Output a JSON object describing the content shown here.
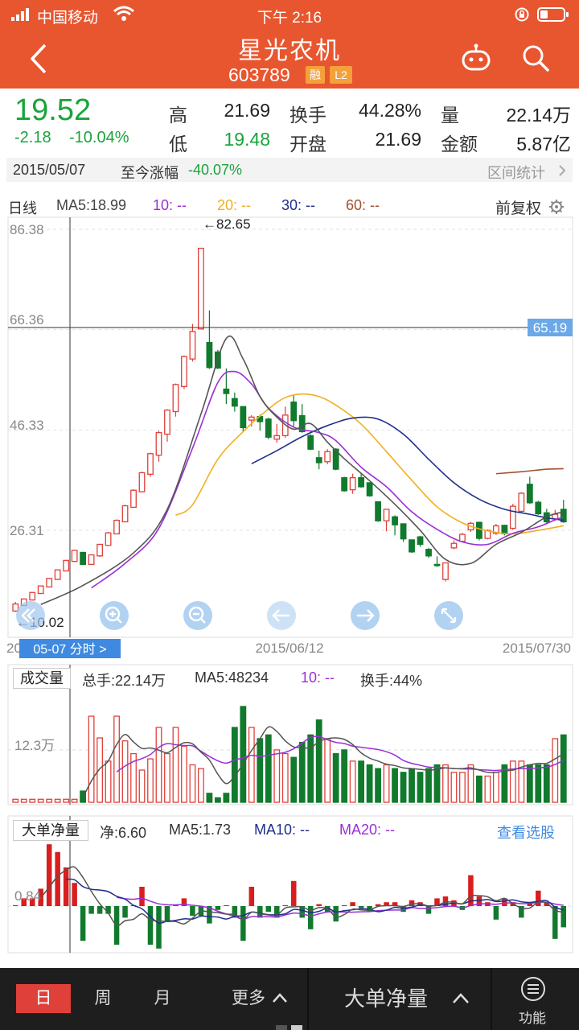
{
  "status": {
    "carrier": "中国移动",
    "time": "下午 2:16"
  },
  "header": {
    "title": "星光农机",
    "code": "603789",
    "tag_margin": "融",
    "tag_level": "L2"
  },
  "quote": {
    "price": "19.52",
    "change": "-2.18",
    "change_pct": "-10.04%",
    "high_label": "高",
    "high": "21.69",
    "low_label": "低",
    "low": "19.48",
    "turnover_label": "换手",
    "turnover": "44.28%",
    "open_label": "开盘",
    "open": "21.69",
    "volume_label": "量",
    "volume": "22.14万",
    "amount_label": "金额",
    "amount": "5.87亿"
  },
  "period": {
    "date": "2015/05/07",
    "label": "至今涨幅",
    "value": "-40.07%",
    "stats": "区间统计"
  },
  "chart_header": {
    "kline": "日线",
    "ma5": "MA5:18.99",
    "ma10": "10: --",
    "ma20": "20: --",
    "ma30": "30: --",
    "ma60": "60: --",
    "adjust": "前复权"
  },
  "main_chart": {
    "annot_high": "←82.65",
    "annot_low": "←10.02",
    "crosshair_price": "65.19",
    "yticks": [
      "86.38",
      "66.36",
      "46.33",
      "26.31"
    ],
    "x_left": "20",
    "x_mid": "2015/06/12",
    "x_right": "2015/07/30",
    "minute_btn": "05-07 分时 >"
  },
  "volume_panel": {
    "title": "成交量",
    "total": "总手:22.14万",
    "ma5": "MA5:48234",
    "ma10": "10: --",
    "turnover": "换手:44%",
    "ytick": "12.3万"
  },
  "netflow_panel": {
    "title": "大单净量",
    "net": "净:6.60",
    "ma5": "MA5:1.73",
    "ma10": "MA10: --",
    "ma20": "MA20: --",
    "link": "查看选股",
    "ytick": "0.84"
  },
  "bottom": {
    "day": "日",
    "week": "周",
    "month": "月",
    "more": "更多",
    "indicator": "大单净量",
    "func": "功能"
  },
  "colors": {
    "header_bg": "#e8562f",
    "up": "#e0403a",
    "down": "#117a2d",
    "price_green": "#19a43b",
    "ma5": "#555555",
    "ma10": "#9b2fd6",
    "ma20": "#f0b020",
    "ma30": "#1f2f8a",
    "ma60": "#a0522d"
  },
  "chart_data": [
    {
      "type": "candlestick",
      "title": "日线",
      "ylim": [
        10.02,
        86.38
      ],
      "yticks": [
        86.38,
        66.36,
        46.33,
        26.31
      ],
      "x_labels": [
        "2015/06/12",
        "2015/07/30"
      ],
      "annotations": [
        {
          "text": "←82.65",
          "value": 82.65
        },
        {
          "text": "←10.02",
          "value": 10.02
        }
      ],
      "crosshair": {
        "value": 65.19
      },
      "candles": [
        [
          10.2,
          11.6,
          10.0,
          12.0
        ],
        [
          11.3,
          12.6,
          11.2,
          12.7
        ],
        [
          12.4,
          13.9,
          12.3,
          14.0
        ],
        [
          13.7,
          15.2,
          13.6,
          15.3
        ],
        [
          15.0,
          16.7,
          14.9,
          16.8
        ],
        [
          16.5,
          18.4,
          16.4,
          18.5
        ],
        [
          18.2,
          20.3,
          18.1,
          20.4
        ],
        [
          20.1,
          22.3,
          20.0,
          22.4
        ],
        [
          21.9,
          19.5,
          19.4,
          21.9
        ],
        [
          19.5,
          21.4,
          19.4,
          21.5
        ],
        [
          21.2,
          23.5,
          21.0,
          23.6
        ],
        [
          23.3,
          25.8,
          23.2,
          26.0
        ],
        [
          25.6,
          28.3,
          25.5,
          28.5
        ],
        [
          28.0,
          31.2,
          27.9,
          31.4
        ],
        [
          30.9,
          34.3,
          30.8,
          34.5
        ],
        [
          34.0,
          37.8,
          33.9,
          38.0
        ],
        [
          37.5,
          41.6,
          37.0,
          41.8
        ],
        [
          41.3,
          45.8,
          40.0,
          46.2
        ],
        [
          45.5,
          50.3,
          44.0,
          50.5
        ],
        [
          50.0,
          55.4,
          49.0,
          55.6
        ],
        [
          55.0,
          61.0,
          54.5,
          61.2
        ],
        [
          60.5,
          66.0,
          60.0,
          67.5
        ],
        [
          66.5,
          82.6,
          66.4,
          82.6
        ],
        [
          63.8,
          58.8,
          58.5,
          70.2
        ],
        [
          61.9,
          58.7,
          58.5,
          62.3
        ],
        [
          54.5,
          53.6,
          51.5,
          58.6
        ],
        [
          52.6,
          51.1,
          50.0,
          53.8
        ],
        [
          51.0,
          46.8,
          46.0,
          51.0
        ],
        [
          48.3,
          48.9,
          47.0,
          49.3
        ],
        [
          49.0,
          48.0,
          46.2,
          49.4
        ],
        [
          48.5,
          44.9,
          44.5,
          48.8
        ],
        [
          44.5,
          45.2,
          43.8,
          47.5
        ],
        [
          45.2,
          49.3,
          44.8,
          51.0
        ],
        [
          51.9,
          48.2,
          47.0,
          53.2
        ],
        [
          49.2,
          46.0,
          45.8,
          51.5
        ],
        [
          45.2,
          42.5,
          42.3,
          45.5
        ],
        [
          40.8,
          39.8,
          38.5,
          42.2
        ],
        [
          40.0,
          42.0,
          39.5,
          42.5
        ],
        [
          42.5,
          38.5,
          38.3,
          42.7
        ],
        [
          36.8,
          34.2,
          34.0,
          37.0
        ],
        [
          34.4,
          36.8,
          33.6,
          37.6
        ],
        [
          36.8,
          35.0,
          34.8,
          37.6
        ],
        [
          35.8,
          33.2,
          33.0,
          35.8
        ],
        [
          32.0,
          28.2,
          28.0,
          32.0
        ],
        [
          28.2,
          30.5,
          26.1,
          30.5
        ],
        [
          29.0,
          27.4,
          25.3,
          29.3
        ],
        [
          27.6,
          24.6,
          24.0,
          27.6
        ],
        [
          24.4,
          22.0,
          21.8,
          24.4
        ],
        [
          25.0,
          23.5,
          23.0,
          25.2
        ],
        [
          22.5,
          21.2,
          20.8,
          22.8
        ],
        [
          19.5,
          19.4,
          19.0,
          21.1
        ],
        [
          16.5,
          19.8,
          16.1,
          19.8
        ],
        [
          22.8,
          23.7,
          22.5,
          24.3
        ],
        [
          24.1,
          25.5,
          24.0,
          25.8
        ],
        [
          26.4,
          27.7,
          26.0,
          28.0
        ],
        [
          27.9,
          24.7,
          24.3,
          28.0
        ],
        [
          24.7,
          26.3,
          24.5,
          26.5
        ],
        [
          25.7,
          27.2,
          25.4,
          27.6
        ],
        [
          27.3,
          25.6,
          25.3,
          27.4
        ],
        [
          26.7,
          31.1,
          26.4,
          31.6
        ],
        [
          30.1,
          33.7,
          29.9,
          33.9
        ],
        [
          35.5,
          31.8,
          31.6,
          37.0
        ],
        [
          31.9,
          29.6,
          29.4,
          32.2
        ],
        [
          29.8,
          28.0,
          27.8,
          30.6
        ],
        [
          28.6,
          29.5,
          28.2,
          30.4
        ],
        [
          30.5,
          28.0,
          27.8,
          32.4
        ]
      ],
      "series_ma5": [
        [
          3,
          11.5
        ],
        [
          8,
          15.3
        ],
        [
          14,
          21.8
        ],
        [
          18,
          30.5
        ],
        [
          22,
          49.5
        ],
        [
          25,
          64.6
        ],
        [
          27,
          60.5
        ],
        [
          29,
          53.0
        ],
        [
          31,
          48.9
        ],
        [
          33,
          46.5
        ],
        [
          35,
          47.6
        ],
        [
          37,
          43.9
        ],
        [
          39,
          40.6
        ],
        [
          42,
          36.2
        ],
        [
          45,
          31.5
        ],
        [
          48,
          26.3
        ],
        [
          51,
          20.5
        ],
        [
          54,
          19.7
        ],
        [
          57,
          23.5
        ],
        [
          60,
          25.9
        ],
        [
          63,
          29.0
        ],
        [
          65,
          30.0
        ]
      ],
      "series_ma10": [
        [
          9,
          14.8
        ],
        [
          13,
          19.7
        ],
        [
          17,
          26.7
        ],
        [
          21,
          42.7
        ],
        [
          24,
          55.8
        ],
        [
          26,
          58.0
        ],
        [
          28,
          55.5
        ],
        [
          30,
          50.7
        ],
        [
          33,
          46.9
        ],
        [
          36,
          45.8
        ],
        [
          38,
          44.2
        ],
        [
          41,
          38.9
        ],
        [
          44,
          35.0
        ],
        [
          47,
          30.0
        ],
        [
          50,
          26.5
        ],
        [
          53,
          24.0
        ],
        [
          56,
          23.5
        ],
        [
          59,
          25.7
        ],
        [
          62,
          27.0
        ],
        [
          64,
          28.4
        ],
        [
          65,
          29.0
        ]
      ],
      "series_ma20": [
        [
          19,
          29.3
        ],
        [
          21,
          31.4
        ],
        [
          24,
          40.5
        ],
        [
          27,
          46.0
        ],
        [
          30,
          50.5
        ],
        [
          32,
          52.8
        ],
        [
          34,
          53.5
        ],
        [
          36,
          53.0
        ],
        [
          38,
          51.3
        ],
        [
          41,
          47.5
        ],
        [
          44,
          42.0
        ],
        [
          47,
          36.3
        ],
        [
          50,
          31.0
        ],
        [
          53,
          27.8
        ],
        [
          56,
          26.2
        ],
        [
          59,
          25.6
        ],
        [
          62,
          26.3
        ],
        [
          65,
          27.2
        ]
      ],
      "series_ma30": [
        [
          28,
          39.6
        ],
        [
          31,
          42.2
        ],
        [
          34,
          45.0
        ],
        [
          37,
          47.2
        ],
        [
          40,
          48.7
        ],
        [
          43,
          48.5
        ],
        [
          46,
          45.5
        ],
        [
          49,
          40.5
        ],
        [
          52,
          35.8
        ],
        [
          55,
          32.5
        ],
        [
          58,
          30.5
        ],
        [
          61,
          29.5
        ],
        [
          63,
          28.8
        ],
        [
          65,
          28.3
        ]
      ],
      "series_ma60": [
        [
          57,
          37.6
        ],
        [
          60,
          38.0
        ],
        [
          63,
          38.5
        ],
        [
          65,
          38.6
        ]
      ]
    },
    {
      "type": "bar",
      "title": "成交量",
      "ytick": "12.3万",
      "values": [
        0.4,
        0.4,
        0.4,
        0.4,
        0.4,
        0.4,
        0.4,
        0.4,
        1.5,
        11.5,
        8.6,
        5.5,
        11.5,
        8.2,
        6.5,
        4.3,
        5.8,
        10.0,
        6.5,
        10.0,
        7.5,
        5.0,
        4.5,
        1.2,
        0.6,
        1.2,
        10.0,
        12.8,
        10.0,
        8.5,
        9.0,
        7.0,
        6.5,
        6.0,
        8.0,
        9.0,
        11.0,
        8.5,
        6.5,
        7.0,
        5.5,
        5.5,
        5.0,
        4.5,
        5.0,
        4.5,
        4.0,
        4.5,
        4.0,
        4.5,
        5.0,
        5.0,
        4.0,
        4.0,
        5.0,
        3.5,
        3.5,
        4.0,
        5.0,
        5.5,
        5.5,
        5.0,
        5.0,
        5.0,
        8.5,
        9.0
      ]
    },
    {
      "type": "bar",
      "title": "大单净量",
      "ytick": "0.84",
      "values": [
        0.0,
        0.4,
        0.4,
        0.9,
        3.2,
        2.8,
        2.0,
        1.2,
        -1.8,
        -0.4,
        -0.4,
        -0.4,
        -2.0,
        -0.6,
        0.0,
        1.0,
        -2.0,
        -2.2,
        -0.8,
        0.0,
        0.4,
        -0.5,
        -0.5,
        -0.9,
        -0.2,
        0.0,
        -0.6,
        -1.8,
        1.0,
        -0.6,
        -0.3,
        -0.6,
        0.0,
        1.3,
        -0.6,
        -1.2,
        0.1,
        -0.3,
        -0.8,
        0.0,
        0.2,
        -0.1,
        -0.3,
        0.1,
        0.2,
        0.2,
        -0.3,
        0.3,
        0.2,
        -0.4,
        0.4,
        0.5,
        0.3,
        -0.2,
        1.6,
        0.5,
        0.2,
        -0.7,
        0.4,
        0.2,
        -0.6,
        0.2,
        0.8,
        0.2,
        -1.7,
        -1.1
      ]
    }
  ]
}
